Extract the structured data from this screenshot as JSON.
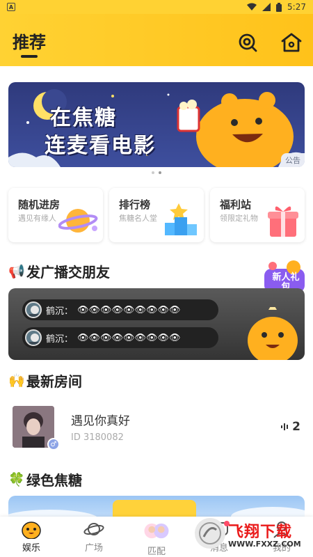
{
  "status_bar": {
    "time": "5:27",
    "left_icon": "A"
  },
  "header": {
    "title": "推荐",
    "search_icon": "search-icon",
    "home_icon": "home-icon"
  },
  "banner": {
    "line1": "在焦糖",
    "line2": "连麦看电影",
    "badge": "公告",
    "pager_count": 2,
    "pager_active": 1
  },
  "entries": [
    {
      "title": "随机进房",
      "subtitle": "遇见有缘人"
    },
    {
      "title": "排行榜",
      "subtitle": "焦糖名人堂"
    },
    {
      "title": "福利站",
      "subtitle": "领限定礼物"
    }
  ],
  "broadcast": {
    "title": "发广播交朋友",
    "new_gift_badge": "新人礼包",
    "messages": [
      {
        "name": "鹤沉：",
        "text": "👁👁👁👁👁👁👁👁👁"
      },
      {
        "name": "鹤沉：",
        "text": "👁👁👁👁👁👁👁👁👁"
      }
    ]
  },
  "latest_rooms": {
    "title": "最新房间",
    "rooms": [
      {
        "name": "遇见你真好",
        "id": "ID 3180082",
        "count": "2"
      }
    ]
  },
  "green_section": {
    "title": "绿色焦糖"
  },
  "tabbar": {
    "tabs": [
      {
        "label": "娱乐",
        "active": true
      },
      {
        "label": "广场",
        "active": false
      },
      {
        "label": "匹配",
        "active": false
      },
      {
        "label": "消息",
        "active": false
      },
      {
        "label": "我的",
        "active": false
      }
    ]
  },
  "watermark": {
    "text": "飞翔下载",
    "url": "WWW.FXXZ.COM"
  },
  "colors": {
    "accent": "#ffc21a",
    "text": "#222222",
    "muted": "#aaaaaa"
  }
}
